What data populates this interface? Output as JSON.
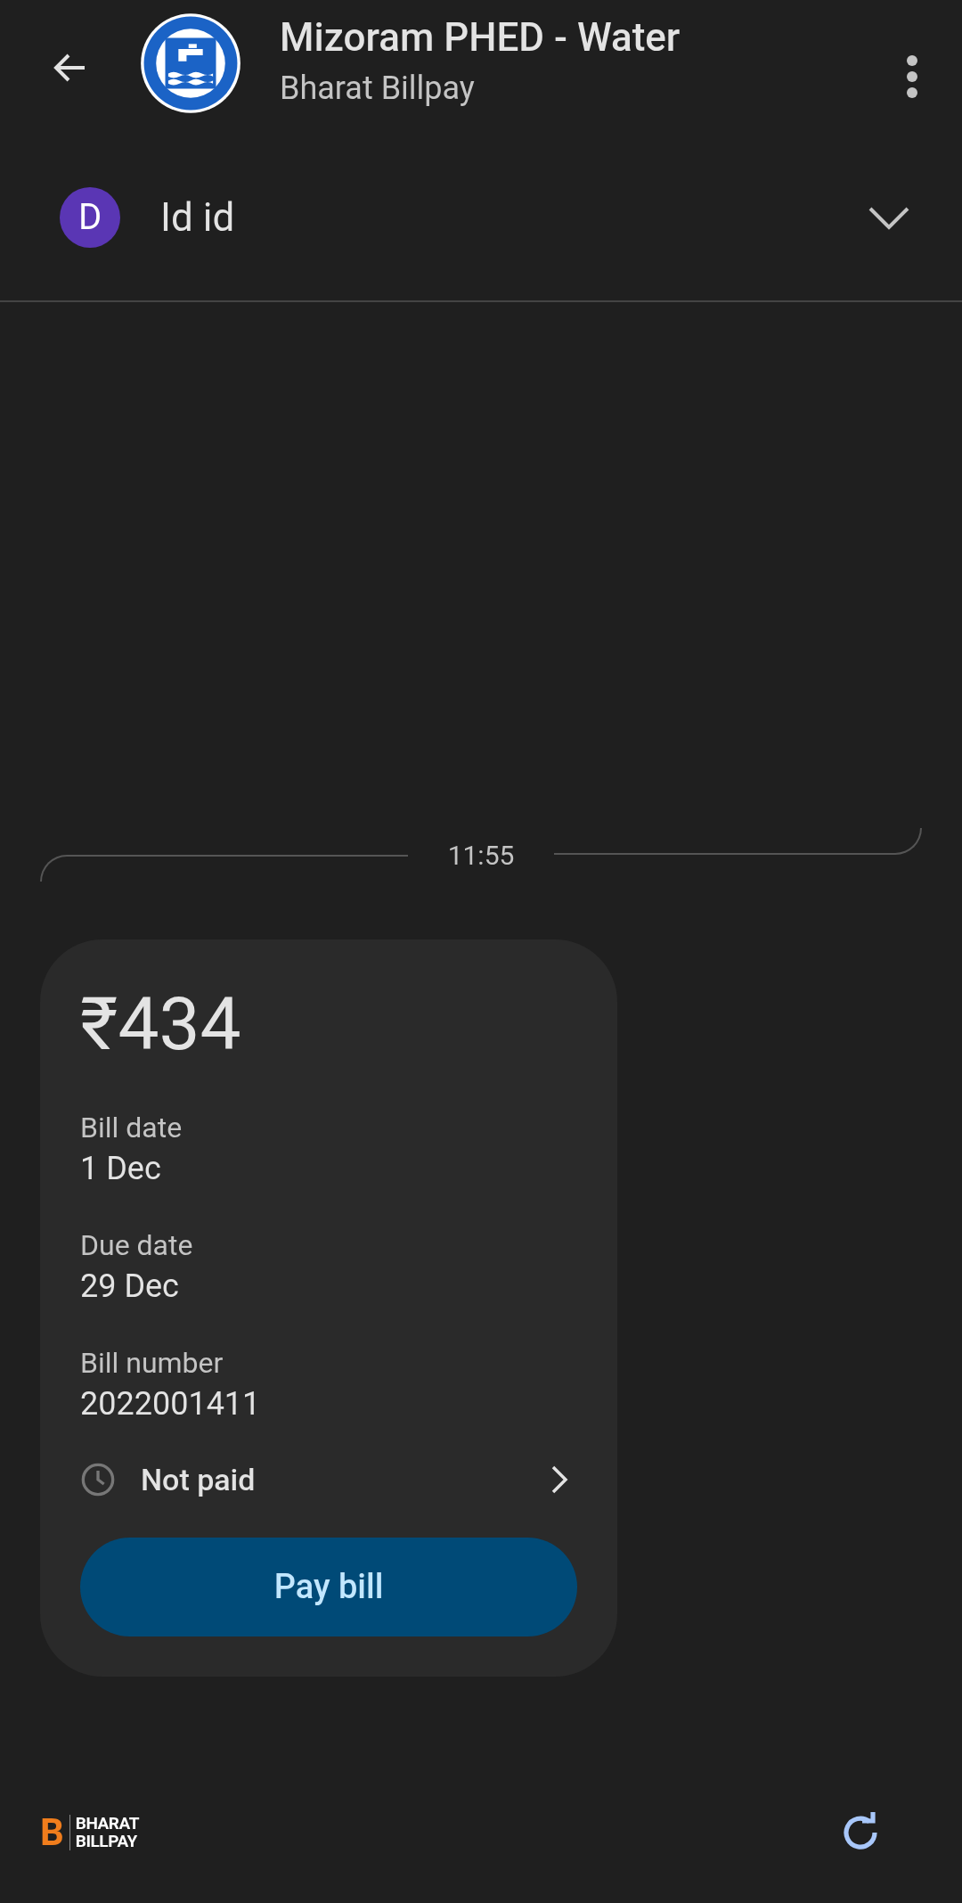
{
  "header": {
    "title": "Mizoram PHED - Water",
    "subtitle": "Bharat Billpay"
  },
  "account": {
    "avatar_letter": "D",
    "name": "Id id"
  },
  "timestamp": "11:55",
  "bill": {
    "amount": "₹434",
    "fields": [
      {
        "label": "Bill date",
        "value": "1 Dec"
      },
      {
        "label": "Due date",
        "value": "29 Dec"
      },
      {
        "label": "Bill number",
        "value": "2022001411"
      }
    ],
    "status": "Not paid",
    "button": "Pay bill"
  },
  "footer": {
    "logo_mark": "B",
    "logo_lines": [
      "BHARAT",
      "BILLPAY"
    ]
  }
}
